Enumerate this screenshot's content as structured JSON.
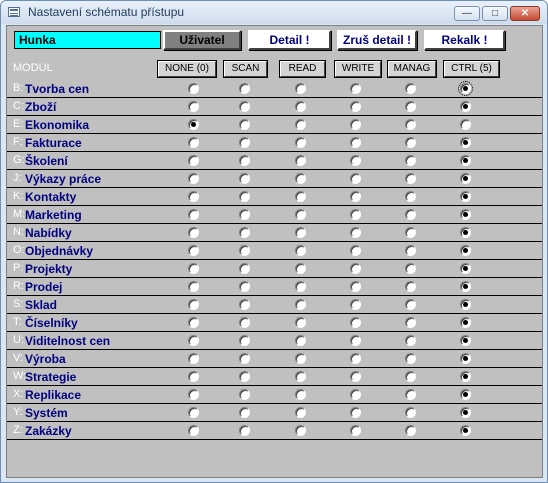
{
  "window": {
    "title": "Nastavení schématu přístupu",
    "minimize_glyph": "—",
    "maximize_glyph": "□",
    "close_glyph": "✕"
  },
  "toolbar": {
    "user_value": "Hunka",
    "user_button": "Uživatel",
    "detail_button": "Detail !",
    "cancel_detail_button": "Zruš detail !",
    "recalc_button": "Rekalk !"
  },
  "header": {
    "modul_label": "MODUL",
    "columns": [
      "NONE (0)",
      "SCAN",
      "READ",
      "WRITE",
      "MANAG",
      "CTRL (5)"
    ]
  },
  "rows": [
    {
      "code": "B:",
      "name": "Tvorba cen",
      "level": 5,
      "focus": true
    },
    {
      "code": "C:",
      "name": "Zboží",
      "level": 5
    },
    {
      "code": "E:",
      "name": "Ekonomika",
      "level": 0
    },
    {
      "code": "F:",
      "name": "Fakturace",
      "level": 5
    },
    {
      "code": "G:",
      "name": "Školení",
      "level": 5
    },
    {
      "code": "J:",
      "name": "Výkazy práce",
      "level": 5
    },
    {
      "code": "K:",
      "name": "Kontakty",
      "level": 5
    },
    {
      "code": "M:",
      "name": "Marketing",
      "level": 5
    },
    {
      "code": "N:",
      "name": "Nabídky",
      "level": 5
    },
    {
      "code": "O:",
      "name": "Objednávky",
      "level": 5
    },
    {
      "code": "P:",
      "name": "Projekty",
      "level": 5
    },
    {
      "code": "R:",
      "name": "Prodej",
      "level": 5
    },
    {
      "code": "S:",
      "name": "Sklad",
      "level": 5
    },
    {
      "code": "T:",
      "name": "Číselníky",
      "level": 5
    },
    {
      "code": "U:",
      "name": "Viditelnost cen",
      "level": 5
    },
    {
      "code": "V:",
      "name": "Výroba",
      "level": 5
    },
    {
      "code": "W:",
      "name": "Strategie",
      "level": 5
    },
    {
      "code": "X:",
      "name": "Replikace",
      "level": 5
    },
    {
      "code": "Y:",
      "name": "Systém",
      "level": 5
    },
    {
      "code": "Z:",
      "name": "Zakázky",
      "level": 5
    }
  ]
}
